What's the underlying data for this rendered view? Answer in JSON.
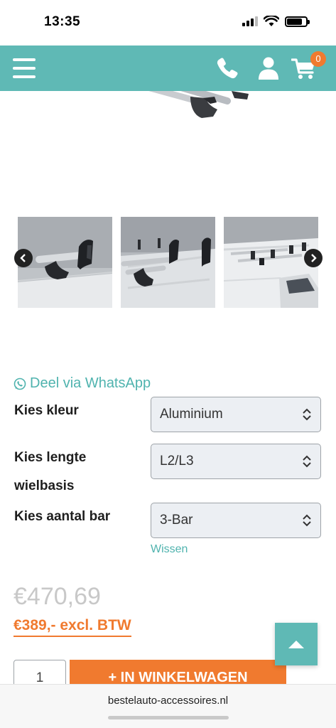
{
  "status_bar": {
    "time": "13:35"
  },
  "header": {
    "cart_count": "0"
  },
  "share": {
    "label": "Deel via WhatsApp"
  },
  "options": [
    {
      "label": "Kies kleur",
      "value": "Aluminium"
    },
    {
      "label": "Kies lengte wielbasis",
      "value": "L2/L3"
    },
    {
      "label": "Kies aantal bar",
      "value": "3-Bar"
    }
  ],
  "clear_label": "Wissen",
  "pricing": {
    "old_price": "€470,69",
    "new_price": "€389,- excl. BTW"
  },
  "cart": {
    "quantity": "1",
    "add_label": "+ IN WINKELWAGEN"
  },
  "browser": {
    "url": "bestelauto-accessoires.nl"
  },
  "colors": {
    "teal": "#5fb9b5",
    "orange": "#f07a2f"
  },
  "icons": [
    "hamburger-menu-icon",
    "phone-icon",
    "user-icon",
    "cart-icon",
    "whatsapp-icon",
    "chevron-left-icon",
    "chevron-right-icon",
    "select-caret-icon",
    "arrow-up-icon"
  ]
}
